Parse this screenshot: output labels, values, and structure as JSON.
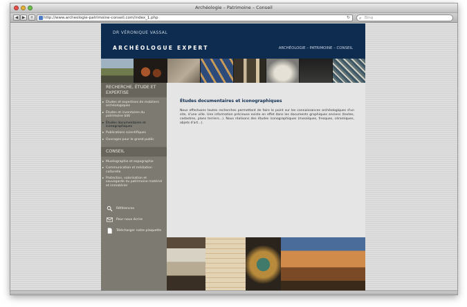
{
  "browser": {
    "window_title": "Archéologie – Patrimoine – Conseil",
    "url": "http://www.archeologie-patrimoine-conseil.com/index_1.php",
    "search_placeholder": "Bing",
    "back_icon": "back-arrow-icon",
    "forward_icon": "forward-arrow-icon"
  },
  "header": {
    "doctor": "DR VÉRONIQUE VASSAL",
    "brand": "ARCHÉOLOGUE EXPERT",
    "tagline": "ARCHÉOLOGIE – PATRIMOINE – CONSEIL"
  },
  "sidebar": {
    "section1": {
      "title": "RECHERCHE, ÉTUDE ET EXPERTISE",
      "items": [
        "Études et expertises de mobiliers archéologiques",
        "Études et inventaires du patrimoine bâti",
        "Études documentaires et iconographiques",
        "Publications scientifiques",
        "Ouvrages pour le grand public"
      ]
    },
    "section2": {
      "title": "CONSEIL",
      "items": [
        "Muséographie et expographie",
        "Communication et médiation culturelle",
        "Protection, valorisation et sauvegarde du patrimoine matériel et immatériel"
      ]
    },
    "links": [
      {
        "label": "Références",
        "icon": "magnifier-icon"
      },
      {
        "label": "Pour nous écrire",
        "icon": "envelope-icon"
      },
      {
        "label": "Télécharger notre plaquette",
        "icon": "document-icon"
      }
    ]
  },
  "main": {
    "title": "Études documentaires et iconographiques",
    "text": "Nous effectuons toutes recherches permettant de faire le point sur les connaissances archéologiques d'un site, d'une ville. Une information précieuse existe en effet dans les documents graphiques anciens (textes, cadastres, plans terriers...). Nous réalisons des études iconographiques (mosaïques, fresques, céramiques, objets d'art...)."
  },
  "colors": {
    "header_bg": "#0e2c4f",
    "sidebar_bg": "#7d7b71",
    "content_bg": "#e5e5e5",
    "title_color": "#0e2c4f"
  }
}
